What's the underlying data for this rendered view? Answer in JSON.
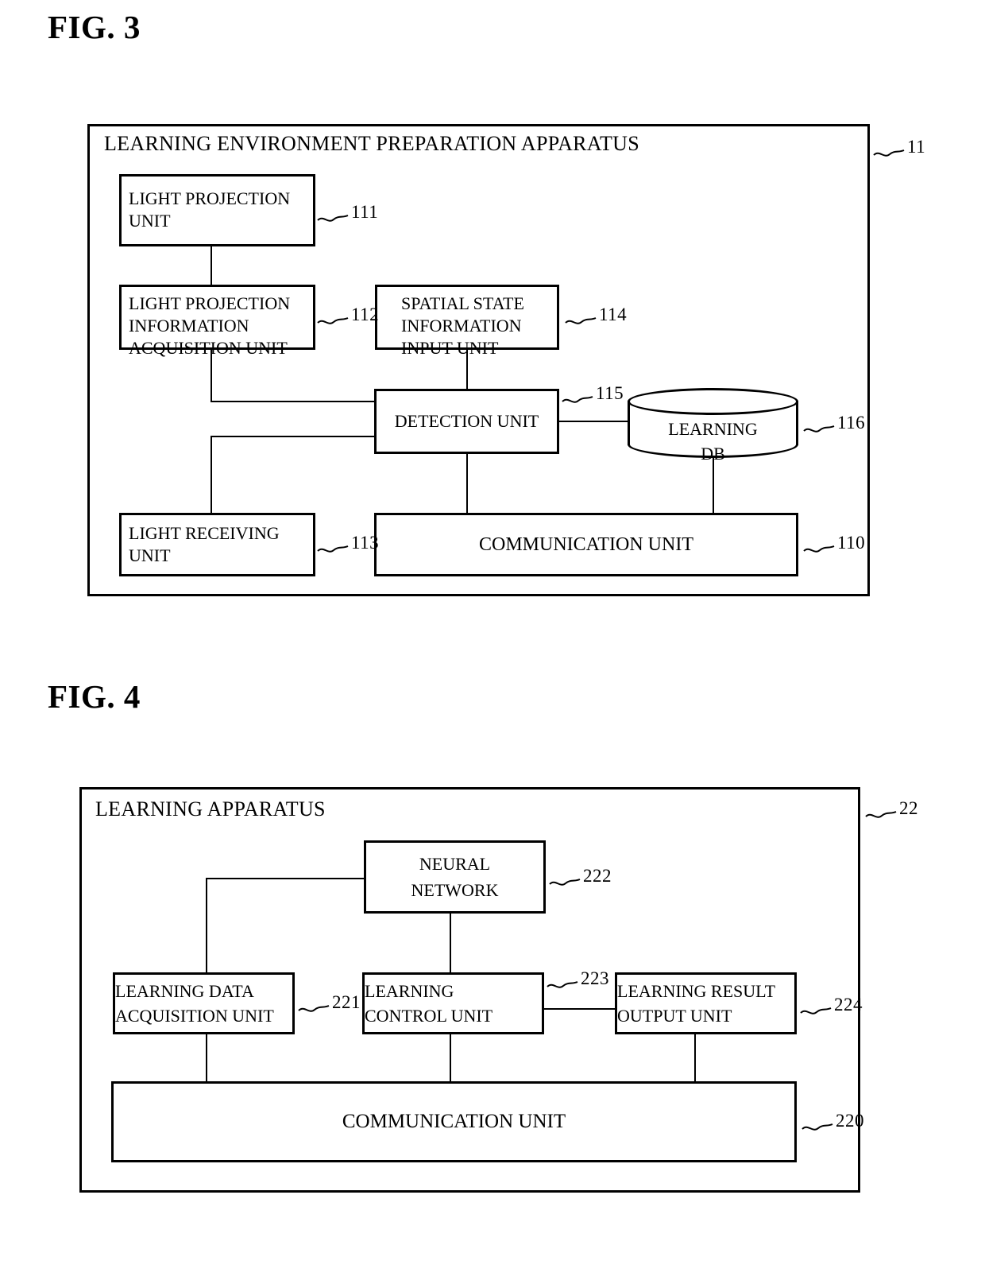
{
  "figures": [
    {
      "title": "FIG. 3",
      "apparatus_title": "LEARNING ENVIRONMENT PREPARATION APPARATUS",
      "apparatus_ref": "11",
      "blocks": [
        {
          "id": "light-projection-unit",
          "label": "LIGHT PROJECTION\nUNIT",
          "ref": "111"
        },
        {
          "id": "light-projection-information-acquisition-unit",
          "label": "LIGHT PROJECTION\nINFORMATION\nACQUISITION UNIT",
          "ref": "112"
        },
        {
          "id": "light-receiving-unit",
          "label": "LIGHT RECEIVING\nUNIT",
          "ref": "113"
        },
        {
          "id": "spatial-state-information-input-unit",
          "label": "SPATIAL STATE\nINFORMATION\nINPUT UNIT",
          "ref": "114"
        },
        {
          "id": "detection-unit",
          "label": "DETECTION UNIT",
          "ref": "115"
        },
        {
          "id": "learning-db",
          "label": "LEARNING\nDB",
          "ref": "116"
        },
        {
          "id": "communication-unit",
          "label": "COMMUNICATION UNIT",
          "ref": "110"
        }
      ]
    },
    {
      "title": "FIG. 4",
      "apparatus_title": "LEARNING APPARATUS",
      "apparatus_ref": "22",
      "blocks": [
        {
          "id": "neural-network",
          "label": "NEURAL\nNETWORK",
          "ref": "222"
        },
        {
          "id": "learning-data-acquisition-unit",
          "label": "LEARNING DATA\nACQUISITION UNIT",
          "ref": "221"
        },
        {
          "id": "learning-control-unit",
          "label": "LEARNING\nCONTROL UNIT",
          "ref": "223"
        },
        {
          "id": "learning-result-output-unit",
          "label": "LEARNING RESULT\nOUTPUT UNIT",
          "ref": "224"
        },
        {
          "id": "communication-unit",
          "label": "COMMUNICATION UNIT",
          "ref": "220"
        }
      ]
    }
  ]
}
